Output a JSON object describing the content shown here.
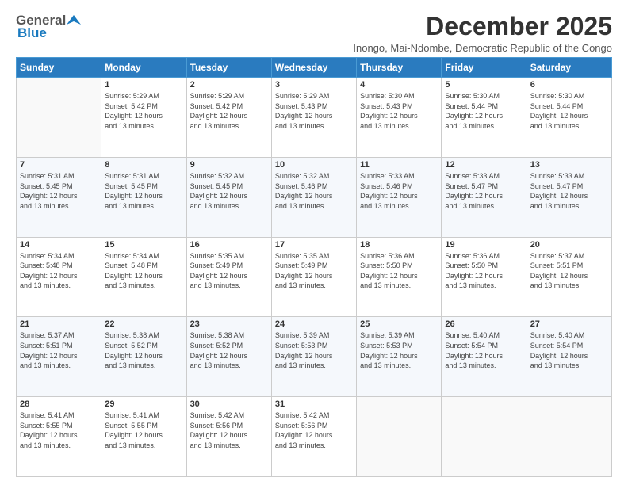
{
  "header": {
    "logo_general": "General",
    "logo_blue": "Blue",
    "month_year": "December 2025",
    "location": "Inongo, Mai-Ndombe, Democratic Republic of the Congo"
  },
  "days_of_week": [
    "Sunday",
    "Monday",
    "Tuesday",
    "Wednesday",
    "Thursday",
    "Friday",
    "Saturday"
  ],
  "weeks": [
    [
      {
        "day": "",
        "info": ""
      },
      {
        "day": "1",
        "info": "Sunrise: 5:29 AM\nSunset: 5:42 PM\nDaylight: 12 hours\nand 13 minutes."
      },
      {
        "day": "2",
        "info": "Sunrise: 5:29 AM\nSunset: 5:42 PM\nDaylight: 12 hours\nand 13 minutes."
      },
      {
        "day": "3",
        "info": "Sunrise: 5:29 AM\nSunset: 5:43 PM\nDaylight: 12 hours\nand 13 minutes."
      },
      {
        "day": "4",
        "info": "Sunrise: 5:30 AM\nSunset: 5:43 PM\nDaylight: 12 hours\nand 13 minutes."
      },
      {
        "day": "5",
        "info": "Sunrise: 5:30 AM\nSunset: 5:44 PM\nDaylight: 12 hours\nand 13 minutes."
      },
      {
        "day": "6",
        "info": "Sunrise: 5:30 AM\nSunset: 5:44 PM\nDaylight: 12 hours\nand 13 minutes."
      }
    ],
    [
      {
        "day": "7",
        "info": "Sunrise: 5:31 AM\nSunset: 5:45 PM\nDaylight: 12 hours\nand 13 minutes."
      },
      {
        "day": "8",
        "info": "Sunrise: 5:31 AM\nSunset: 5:45 PM\nDaylight: 12 hours\nand 13 minutes."
      },
      {
        "day": "9",
        "info": "Sunrise: 5:32 AM\nSunset: 5:45 PM\nDaylight: 12 hours\nand 13 minutes."
      },
      {
        "day": "10",
        "info": "Sunrise: 5:32 AM\nSunset: 5:46 PM\nDaylight: 12 hours\nand 13 minutes."
      },
      {
        "day": "11",
        "info": "Sunrise: 5:33 AM\nSunset: 5:46 PM\nDaylight: 12 hours\nand 13 minutes."
      },
      {
        "day": "12",
        "info": "Sunrise: 5:33 AM\nSunset: 5:47 PM\nDaylight: 12 hours\nand 13 minutes."
      },
      {
        "day": "13",
        "info": "Sunrise: 5:33 AM\nSunset: 5:47 PM\nDaylight: 12 hours\nand 13 minutes."
      }
    ],
    [
      {
        "day": "14",
        "info": "Sunrise: 5:34 AM\nSunset: 5:48 PM\nDaylight: 12 hours\nand 13 minutes."
      },
      {
        "day": "15",
        "info": "Sunrise: 5:34 AM\nSunset: 5:48 PM\nDaylight: 12 hours\nand 13 minutes."
      },
      {
        "day": "16",
        "info": "Sunrise: 5:35 AM\nSunset: 5:49 PM\nDaylight: 12 hours\nand 13 minutes."
      },
      {
        "day": "17",
        "info": "Sunrise: 5:35 AM\nSunset: 5:49 PM\nDaylight: 12 hours\nand 13 minutes."
      },
      {
        "day": "18",
        "info": "Sunrise: 5:36 AM\nSunset: 5:50 PM\nDaylight: 12 hours\nand 13 minutes."
      },
      {
        "day": "19",
        "info": "Sunrise: 5:36 AM\nSunset: 5:50 PM\nDaylight: 12 hours\nand 13 minutes."
      },
      {
        "day": "20",
        "info": "Sunrise: 5:37 AM\nSunset: 5:51 PM\nDaylight: 12 hours\nand 13 minutes."
      }
    ],
    [
      {
        "day": "21",
        "info": "Sunrise: 5:37 AM\nSunset: 5:51 PM\nDaylight: 12 hours\nand 13 minutes."
      },
      {
        "day": "22",
        "info": "Sunrise: 5:38 AM\nSunset: 5:52 PM\nDaylight: 12 hours\nand 13 minutes."
      },
      {
        "day": "23",
        "info": "Sunrise: 5:38 AM\nSunset: 5:52 PM\nDaylight: 12 hours\nand 13 minutes."
      },
      {
        "day": "24",
        "info": "Sunrise: 5:39 AM\nSunset: 5:53 PM\nDaylight: 12 hours\nand 13 minutes."
      },
      {
        "day": "25",
        "info": "Sunrise: 5:39 AM\nSunset: 5:53 PM\nDaylight: 12 hours\nand 13 minutes."
      },
      {
        "day": "26",
        "info": "Sunrise: 5:40 AM\nSunset: 5:54 PM\nDaylight: 12 hours\nand 13 minutes."
      },
      {
        "day": "27",
        "info": "Sunrise: 5:40 AM\nSunset: 5:54 PM\nDaylight: 12 hours\nand 13 minutes."
      }
    ],
    [
      {
        "day": "28",
        "info": "Sunrise: 5:41 AM\nSunset: 5:55 PM\nDaylight: 12 hours\nand 13 minutes."
      },
      {
        "day": "29",
        "info": "Sunrise: 5:41 AM\nSunset: 5:55 PM\nDaylight: 12 hours\nand 13 minutes."
      },
      {
        "day": "30",
        "info": "Sunrise: 5:42 AM\nSunset: 5:56 PM\nDaylight: 12 hours\nand 13 minutes."
      },
      {
        "day": "31",
        "info": "Sunrise: 5:42 AM\nSunset: 5:56 PM\nDaylight: 12 hours\nand 13 minutes."
      },
      {
        "day": "",
        "info": ""
      },
      {
        "day": "",
        "info": ""
      },
      {
        "day": "",
        "info": ""
      }
    ]
  ]
}
